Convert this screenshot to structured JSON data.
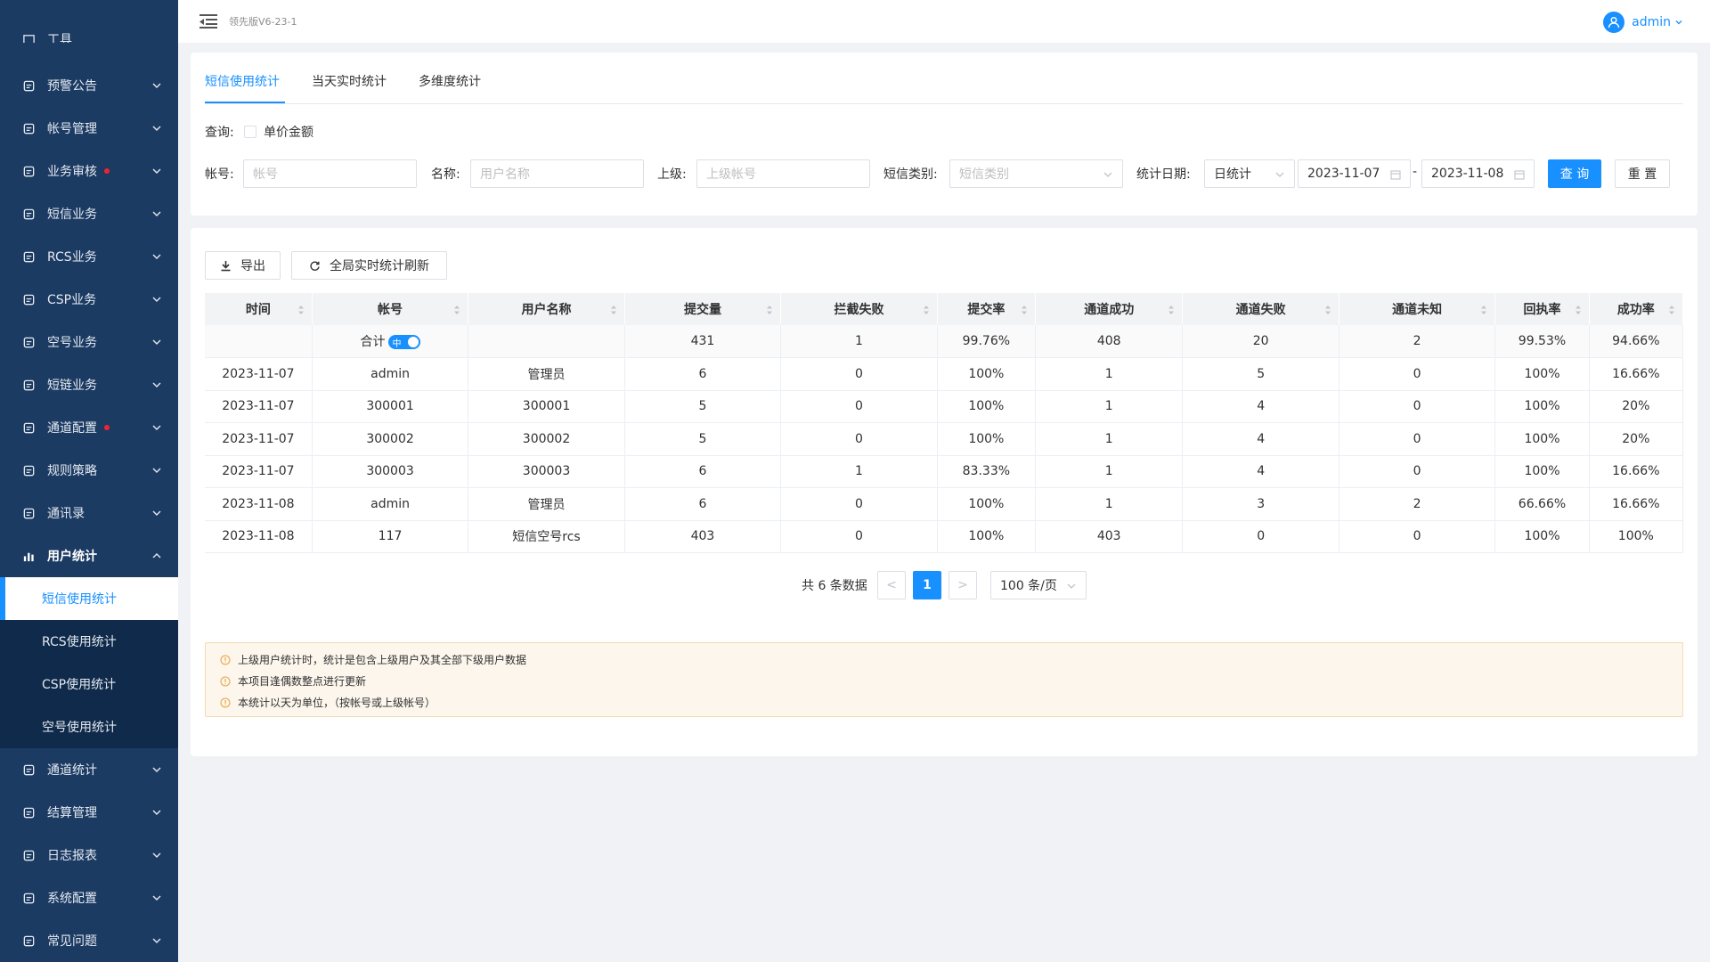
{
  "header": {
    "version": "领先版V6-23-1",
    "user": "admin"
  },
  "sidebar": {
    "top_partial": "工具",
    "items": [
      {
        "label": "预警公告",
        "icon": "bell-icon"
      },
      {
        "label": "帐号管理",
        "icon": "account-icon"
      },
      {
        "label": "业务审核",
        "icon": "audit-icon",
        "dot": true
      },
      {
        "label": "短信业务",
        "icon": "message-icon"
      },
      {
        "label": "RCS业务",
        "icon": "rcs-icon"
      },
      {
        "label": "CSP业务",
        "icon": "csp-icon"
      },
      {
        "label": "空号业务",
        "icon": "empty-number-icon"
      },
      {
        "label": "短链业务",
        "icon": "short-link-icon"
      },
      {
        "label": "通道配置",
        "icon": "channel-config-icon",
        "dot": true
      },
      {
        "label": "规则策略",
        "icon": "rule-icon"
      },
      {
        "label": "通讯录",
        "icon": "contacts-icon"
      },
      {
        "label": "用户统计",
        "icon": "bar-chart-icon",
        "active": true
      }
    ],
    "submenu": [
      {
        "label": "短信使用统计",
        "active": true
      },
      {
        "label": "RCS使用统计"
      },
      {
        "label": "CSP使用统计"
      },
      {
        "label": "空号使用统计"
      }
    ],
    "bottom_items": [
      {
        "label": "通道统计",
        "icon": "channel-stat-icon"
      },
      {
        "label": "结算管理",
        "icon": "settlement-icon"
      },
      {
        "label": "日志报表",
        "icon": "log-icon"
      },
      {
        "label": "系统配置",
        "icon": "settings-icon"
      },
      {
        "label": "常见问题",
        "icon": "help-icon"
      }
    ]
  },
  "tabs": [
    "短信使用统计",
    "当天实时统计",
    "多维度统计"
  ],
  "filters": {
    "query_label": "查询:",
    "unit_price_label": "单价金额",
    "account_label": "帐号:",
    "account_placeholder": "帐号",
    "name_label": "名称:",
    "name_placeholder": "用户名称",
    "parent_label": "上级:",
    "parent_placeholder": "上级帐号",
    "sms_type_label": "短信类别:",
    "sms_type_placeholder": "短信类别",
    "date_label": "统计日期:",
    "period_value": "日统计",
    "start_date": "2023-11-07",
    "date_sep": "-",
    "end_date": "2023-11-08",
    "search_btn": "查 询",
    "reset_btn": "重 置"
  },
  "toolbar": {
    "export_btn": "导出",
    "refresh_btn": "全局实时统计刷新"
  },
  "table": {
    "columns": [
      "时间",
      "帐号",
      "用户名称",
      "提交量",
      "拦截失败",
      "提交率",
      "通道成功",
      "通道失败",
      "通道未知",
      "回执率",
      "成功率"
    ],
    "summary": {
      "label": "合计",
      "toggle": "中",
      "submit": "431",
      "intercept": "1",
      "submit_rate": "99.76%",
      "ch_success": "408",
      "ch_fail": "20",
      "ch_unknown": "2",
      "receipt_rate": "99.53%",
      "success_rate": "94.66%"
    },
    "rows": [
      [
        "2023-11-07",
        "admin",
        "管理员",
        "6",
        "0",
        "100%",
        "1",
        "5",
        "0",
        "100%",
        "16.66%"
      ],
      [
        "2023-11-07",
        "300001",
        "300001",
        "5",
        "0",
        "100%",
        "1",
        "4",
        "0",
        "100%",
        "20%"
      ],
      [
        "2023-11-07",
        "300002",
        "300002",
        "5",
        "0",
        "100%",
        "1",
        "4",
        "0",
        "100%",
        "20%"
      ],
      [
        "2023-11-07",
        "300003",
        "300003",
        "6",
        "1",
        "83.33%",
        "1",
        "4",
        "0",
        "100%",
        "16.66%"
      ],
      [
        "2023-11-08",
        "admin",
        "管理员",
        "6",
        "0",
        "100%",
        "1",
        "3",
        "2",
        "66.66%",
        "16.66%"
      ],
      [
        "2023-11-08",
        "117",
        "短信空号rcs",
        "403",
        "0",
        "100%",
        "403",
        "0",
        "0",
        "100%",
        "100%"
      ]
    ]
  },
  "pagination": {
    "total": "共 6 条数据",
    "prev": "<",
    "current": "1",
    "next": ">",
    "page_size": "100 条/页"
  },
  "notice": [
    "上级用户统计时，统计是包含上级用户及其全部下级用户数据",
    "本项目逢偶数整点进行更新",
    "本统计以天为单位，（按帐号或上级帐号）"
  ],
  "colors": {
    "primary": "#1890ff",
    "sidebar": "#1c3b63",
    "submenu": "#0f2a4a"
  }
}
